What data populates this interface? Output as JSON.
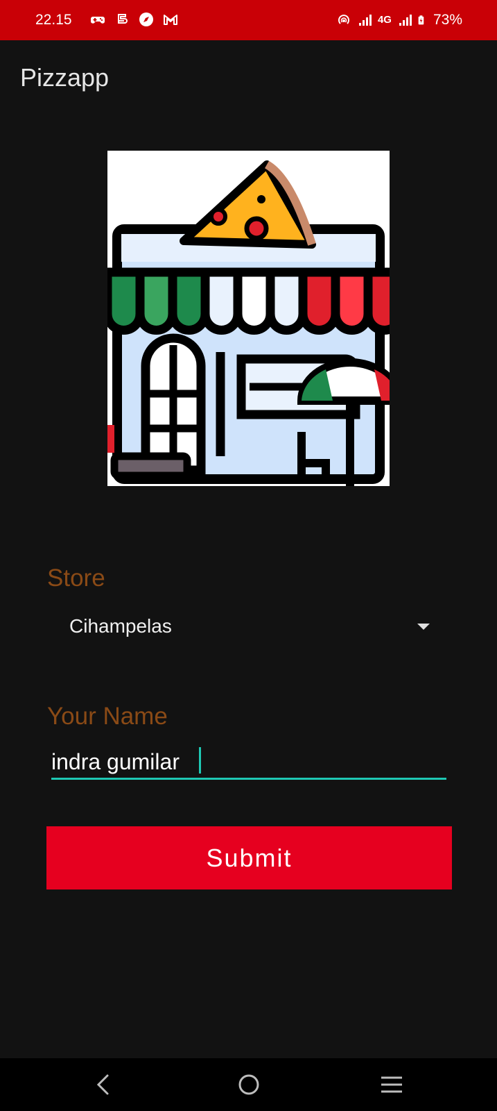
{
  "status_bar": {
    "time": "22.15",
    "network": "4G",
    "battery": "73%",
    "background": "#c90006"
  },
  "app": {
    "title": "Pizzapp"
  },
  "form": {
    "store_label": "Store",
    "store_value": "Cihampelas",
    "name_label": "Your Name",
    "name_value": "indra gumilar",
    "submit_label": "Submit"
  },
  "colors": {
    "background": "#121212",
    "label": "#8a4a16",
    "accent": "#1ec8b4",
    "button": "#e6001f"
  },
  "icons": {
    "status_left": [
      "game-controller-icon",
      "s-app-icon",
      "compass-icon",
      "gmail-icon"
    ],
    "status_right": [
      "hotspot-icon",
      "signal-icon",
      "signal-icon",
      "battery-charging-icon"
    ],
    "nav": [
      "back-icon",
      "home-icon",
      "recents-icon"
    ],
    "store_image": "pizza-store-icon"
  }
}
